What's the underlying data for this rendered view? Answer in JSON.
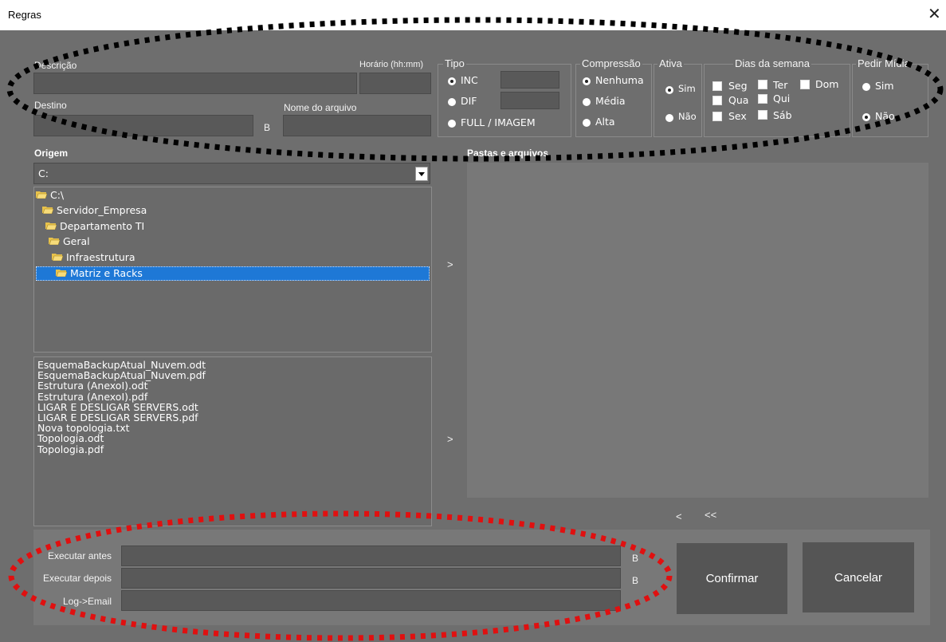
{
  "window": {
    "title": "Regras"
  },
  "header": {
    "descricao_label": "Descrição",
    "horario_label": "Horário (hh:mm)",
    "destino_label": "Destino",
    "destino_suffix": "B",
    "nome_arquivo_label": "Nome do arquivo",
    "tipo": {
      "label": "Tipo",
      "options": [
        "INC",
        "DIF",
        "FULL / IMAGEM"
      ],
      "selected": "INC"
    },
    "compressao": {
      "label": "Compressão",
      "options": [
        "Nenhuma",
        "Média",
        "Alta"
      ],
      "selected": "Nenhuma"
    },
    "ativa": {
      "label": "Ativa",
      "options": [
        "Sim",
        "Não"
      ],
      "selected": "Sim"
    },
    "dias": {
      "label": "Dias da semana",
      "days": [
        "Seg",
        "Ter",
        "Dom",
        "Qua",
        "Qui",
        "Sex",
        "Sáb"
      ]
    },
    "pedir_midia": {
      "label": "Pedir Mídia",
      "options": [
        "Sim",
        "Não"
      ],
      "selected": "Não"
    }
  },
  "origem": {
    "label": "Origem",
    "drive": "C:",
    "tree": [
      "C:\\",
      "Servidor_Empresa",
      "Departamento TI",
      "Geral",
      "Infraestrutura",
      "Matriz e Racks"
    ],
    "selected_folder": "Matriz e Racks",
    "files": [
      "EsquemaBackupAtual_Nuvem.odt",
      "EsquemaBackupAtual_Nuvem.pdf",
      "Estrutura (AnexoI).odt",
      "Estrutura (AnexoI).pdf",
      "LIGAR E DESLIGAR SERVERS.odt",
      "LIGAR E DESLIGAR SERVERS.pdf",
      "Nova topologia.txt",
      "Topologia.odt",
      "Topologia.pdf"
    ]
  },
  "pastas": {
    "label": "Pastas e arquivos"
  },
  "controls": {
    "add_folder": ">",
    "add_file": ">",
    "remove": "<",
    "remove_all": "<<"
  },
  "footer": {
    "executar_antes_label": "Executar antes",
    "executar_antes_suffix": "B",
    "executar_depois_label": "Executar depois",
    "executar_depois_suffix": "B",
    "log_email_label": "Log->Email",
    "confirm_label": "Confirmar",
    "cancel_label": "Cancelar"
  },
  "annotations": {
    "top_ellipse_color": "#000000",
    "bottom_ellipse_color": "#e01010"
  }
}
